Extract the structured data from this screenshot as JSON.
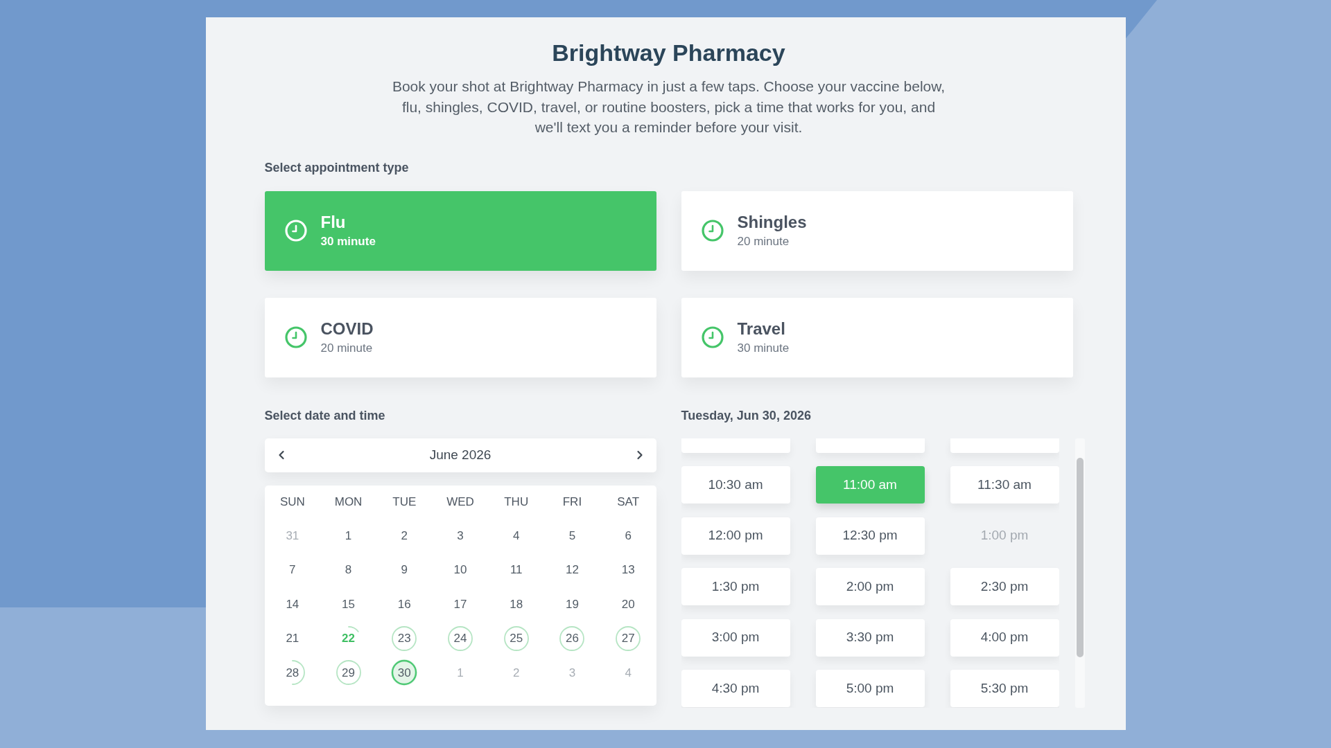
{
  "header": {
    "title": "Brightway Pharmacy",
    "intro": "Book your shot at Brightway Pharmacy in just a few taps. Choose your vaccine below, flu, shingles, COVID, travel, or routine boosters, pick a time that works for you, and we'll text you a reminder before your visit."
  },
  "appointment_types": {
    "label": "Select appointment type",
    "options": [
      {
        "name": "Flu",
        "duration": "30 minute",
        "selected": true
      },
      {
        "name": "Shingles",
        "duration": "20 minute",
        "selected": false
      },
      {
        "name": "COVID",
        "duration": "20 minute",
        "selected": false
      },
      {
        "name": "Travel",
        "duration": "30 minute",
        "selected": false
      }
    ]
  },
  "date_time": {
    "label": "Select date and time",
    "calendar": {
      "month": "June 2026",
      "weekdays": [
        "SUN",
        "MON",
        "TUE",
        "WED",
        "THU",
        "FRI",
        "SAT"
      ],
      "weeks": [
        [
          {
            "day": "31",
            "outside": true,
            "today": false,
            "selected": false
          },
          {
            "day": "1",
            "outside": false,
            "today": false,
            "selected": false
          },
          {
            "day": "2",
            "outside": false,
            "today": false,
            "selected": false
          },
          {
            "day": "3",
            "outside": false,
            "today": false,
            "selected": false
          },
          {
            "day": "4",
            "outside": false,
            "today": false,
            "selected": false
          },
          {
            "day": "5",
            "outside": false,
            "today": false,
            "selected": false
          },
          {
            "day": "6",
            "outside": false,
            "today": false,
            "selected": false
          }
        ],
        [
          {
            "day": "7",
            "outside": false,
            "today": false,
            "selected": false
          },
          {
            "day": "8",
            "outside": false,
            "today": false,
            "selected": false
          },
          {
            "day": "9",
            "outside": false,
            "today": false,
            "selected": false
          },
          {
            "day": "10",
            "outside": false,
            "today": false,
            "selected": false
          },
          {
            "day": "11",
            "outside": false,
            "today": false,
            "selected": false
          },
          {
            "day": "12",
            "outside": false,
            "today": false,
            "selected": false
          },
          {
            "day": "13",
            "outside": false,
            "today": false,
            "selected": false
          }
        ],
        [
          {
            "day": "14",
            "outside": false,
            "today": false,
            "selected": false
          },
          {
            "day": "15",
            "outside": false,
            "today": false,
            "selected": false
          },
          {
            "day": "16",
            "outside": false,
            "today": false,
            "selected": false
          },
          {
            "day": "17",
            "outside": false,
            "today": false,
            "selected": false
          },
          {
            "day": "18",
            "outside": false,
            "today": false,
            "selected": false
          },
          {
            "day": "19",
            "outside": false,
            "today": false,
            "selected": false
          },
          {
            "day": "20",
            "outside": false,
            "today": false,
            "selected": false
          }
        ],
        [
          {
            "day": "21",
            "outside": false,
            "today": false,
            "selected": false
          },
          {
            "day": "22",
            "outside": false,
            "today": true,
            "selected": false,
            "level": 0.15
          },
          {
            "day": "23",
            "outside": false,
            "today": false,
            "selected": false,
            "level": 1
          },
          {
            "day": "24",
            "outside": false,
            "today": false,
            "selected": false,
            "level": 1
          },
          {
            "day": "25",
            "outside": false,
            "today": false,
            "selected": false,
            "level": 1
          },
          {
            "day": "26",
            "outside": false,
            "today": false,
            "selected": false,
            "level": 1
          },
          {
            "day": "27",
            "outside": false,
            "today": false,
            "selected": false,
            "level": 1
          }
        ],
        [
          {
            "day": "28",
            "outside": false,
            "today": false,
            "selected": false,
            "level": 0.5
          },
          {
            "day": "29",
            "outside": false,
            "today": false,
            "selected": false,
            "level": 1
          },
          {
            "day": "30",
            "outside": false,
            "today": false,
            "selected": true,
            "level": 1
          },
          {
            "day": "1",
            "outside": true,
            "today": false,
            "selected": false
          },
          {
            "day": "2",
            "outside": true,
            "today": false,
            "selected": false
          },
          {
            "day": "3",
            "outside": true,
            "today": false,
            "selected": false
          },
          {
            "day": "4",
            "outside": true,
            "today": false,
            "selected": false
          }
        ]
      ]
    },
    "selected_date": "Tuesday, Jun 30, 2026",
    "slots": [
      {
        "kind": "cut",
        "selected": false,
        "disabled": false
      },
      {
        "kind": "cut",
        "selected": false,
        "disabled": false
      },
      {
        "kind": "cut",
        "selected": false,
        "disabled": false
      },
      {
        "kind": "time",
        "label": "10:30 am",
        "selected": false,
        "disabled": false
      },
      {
        "kind": "time",
        "label": "11:00 am",
        "selected": true,
        "disabled": false
      },
      {
        "kind": "time",
        "label": "11:30 am",
        "selected": false,
        "disabled": false
      },
      {
        "kind": "time",
        "label": "12:00 pm",
        "selected": false,
        "disabled": false
      },
      {
        "kind": "time",
        "label": "12:30 pm",
        "selected": false,
        "disabled": false
      },
      {
        "kind": "time",
        "label": "1:00 pm",
        "selected": false,
        "disabled": true
      },
      {
        "kind": "time",
        "label": "1:30 pm",
        "selected": false,
        "disabled": false
      },
      {
        "kind": "time",
        "label": "2:00 pm",
        "selected": false,
        "disabled": false
      },
      {
        "kind": "time",
        "label": "2:30 pm",
        "selected": false,
        "disabled": false
      },
      {
        "kind": "time",
        "label": "3:00 pm",
        "selected": false,
        "disabled": false
      },
      {
        "kind": "time",
        "label": "3:30 pm",
        "selected": false,
        "disabled": false
      },
      {
        "kind": "time",
        "label": "4:00 pm",
        "selected": false,
        "disabled": false
      },
      {
        "kind": "time",
        "label": "4:30 pm",
        "selected": false,
        "disabled": false
      },
      {
        "kind": "time",
        "label": "5:00 pm",
        "selected": false,
        "disabled": false
      },
      {
        "kind": "time",
        "label": "5:30 pm",
        "selected": false,
        "disabled": false
      }
    ]
  }
}
